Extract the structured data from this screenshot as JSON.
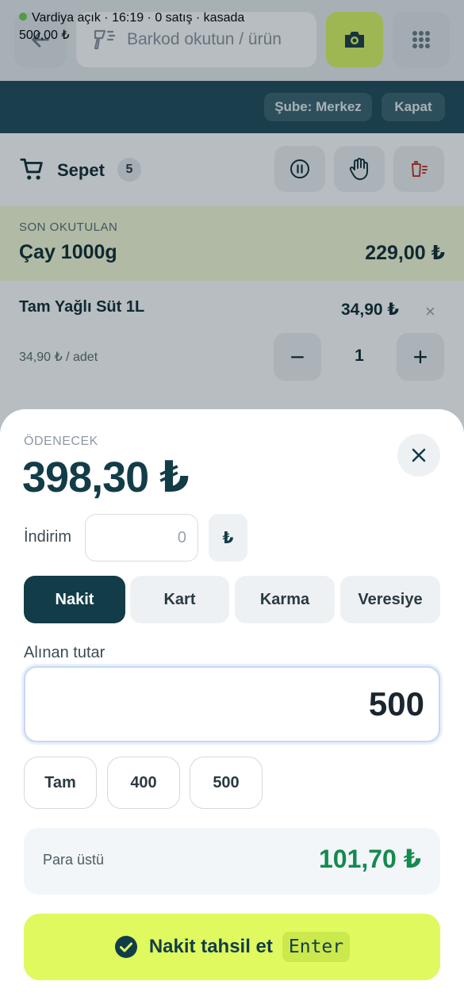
{
  "topbar": {
    "search": {
      "placeholder": "Barkod okutun / ürün",
      "value": ""
    },
    "icons": {
      "back": "arrow-left-icon",
      "barcode": "barcode-scanner-icon",
      "camera": "camera-icon",
      "grid": "grid-dots-icon"
    },
    "colors": {
      "camera_button": "#dbf763"
    }
  },
  "shift": {
    "status": "Vardiya açık · 16:19 · 0 satış · kasada",
    "amount": "500,00 ₺",
    "branch_label": "Şube: Merkez",
    "close_label": "Kapat",
    "status_color": "#6fcf4e"
  },
  "cart": {
    "title": "Sepet",
    "count": "5",
    "actions": [
      "pause-icon",
      "hand-icon",
      "clear-cart-icon"
    ]
  },
  "last_scanned": {
    "label": "SON OKUTULAN",
    "name": "Çay 1000g",
    "price": "229,00 ₺"
  },
  "items": [
    {
      "name": "Tam Yağlı Süt 1L",
      "price": "34,90 ₺",
      "unit_price": "34,90 ₺ / adet",
      "qty": "1",
      "minus": "−",
      "plus": "+",
      "remove": "×"
    }
  ],
  "payment": {
    "label": "ÖDENECEK",
    "amount": "398,30 ₺",
    "discount": {
      "label": "İndirim",
      "placeholder": "0",
      "value": "",
      "unit": "₺"
    },
    "methods": [
      {
        "label": "Nakit",
        "active": true
      },
      {
        "label": "Kart",
        "active": false
      },
      {
        "label": "Karma",
        "active": false
      },
      {
        "label": "Veresiye",
        "active": false
      }
    ],
    "received": {
      "label": "Alınan tutar",
      "value": "500"
    },
    "quick_amounts": [
      "Tam",
      "400",
      "500"
    ],
    "change": {
      "label": "Para üstü",
      "value": "101,70 ₺",
      "color": "#138a4e"
    },
    "submit": {
      "label": "Nakit tahsil et",
      "shortcut": "Enter",
      "color": "#dff95e"
    }
  }
}
